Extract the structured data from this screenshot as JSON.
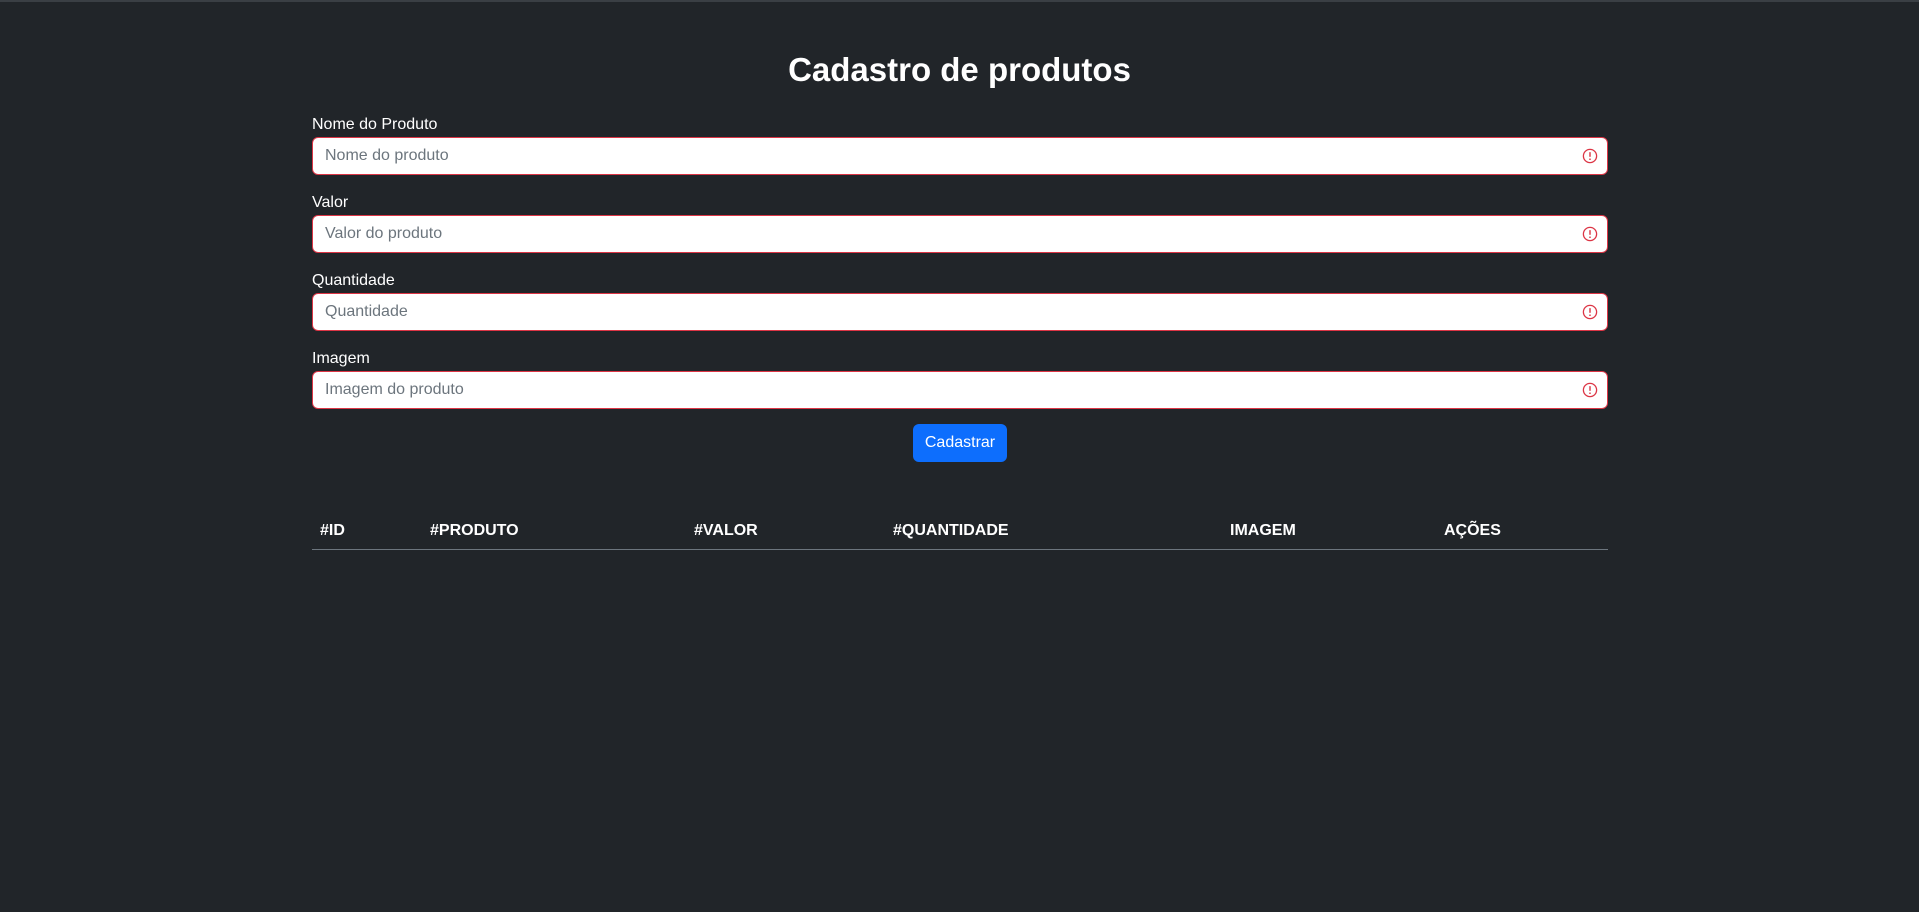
{
  "header": {
    "title": "Cadastro de produtos"
  },
  "form": {
    "fields": [
      {
        "label": "Nome do Produto",
        "placeholder": "Nome do produto",
        "value": ""
      },
      {
        "label": "Valor",
        "placeholder": "Valor do produto",
        "value": ""
      },
      {
        "label": "Quantidade",
        "placeholder": "Quantidade",
        "value": ""
      },
      {
        "label": "Imagem",
        "placeholder": "Imagem do produto",
        "value": ""
      }
    ],
    "submit_label": "Cadastrar",
    "invalid_icon": "exclamation-circle-icon",
    "invalid_color": "#dc3545",
    "button_color": "#0d6efd"
  },
  "table": {
    "columns": [
      "#ID",
      "#PRODUTO",
      "#VALOR",
      "#QUANTIDADE",
      "IMAGEM",
      "AÇÕES"
    ],
    "rows": []
  },
  "theme": {
    "background": "#212529"
  }
}
